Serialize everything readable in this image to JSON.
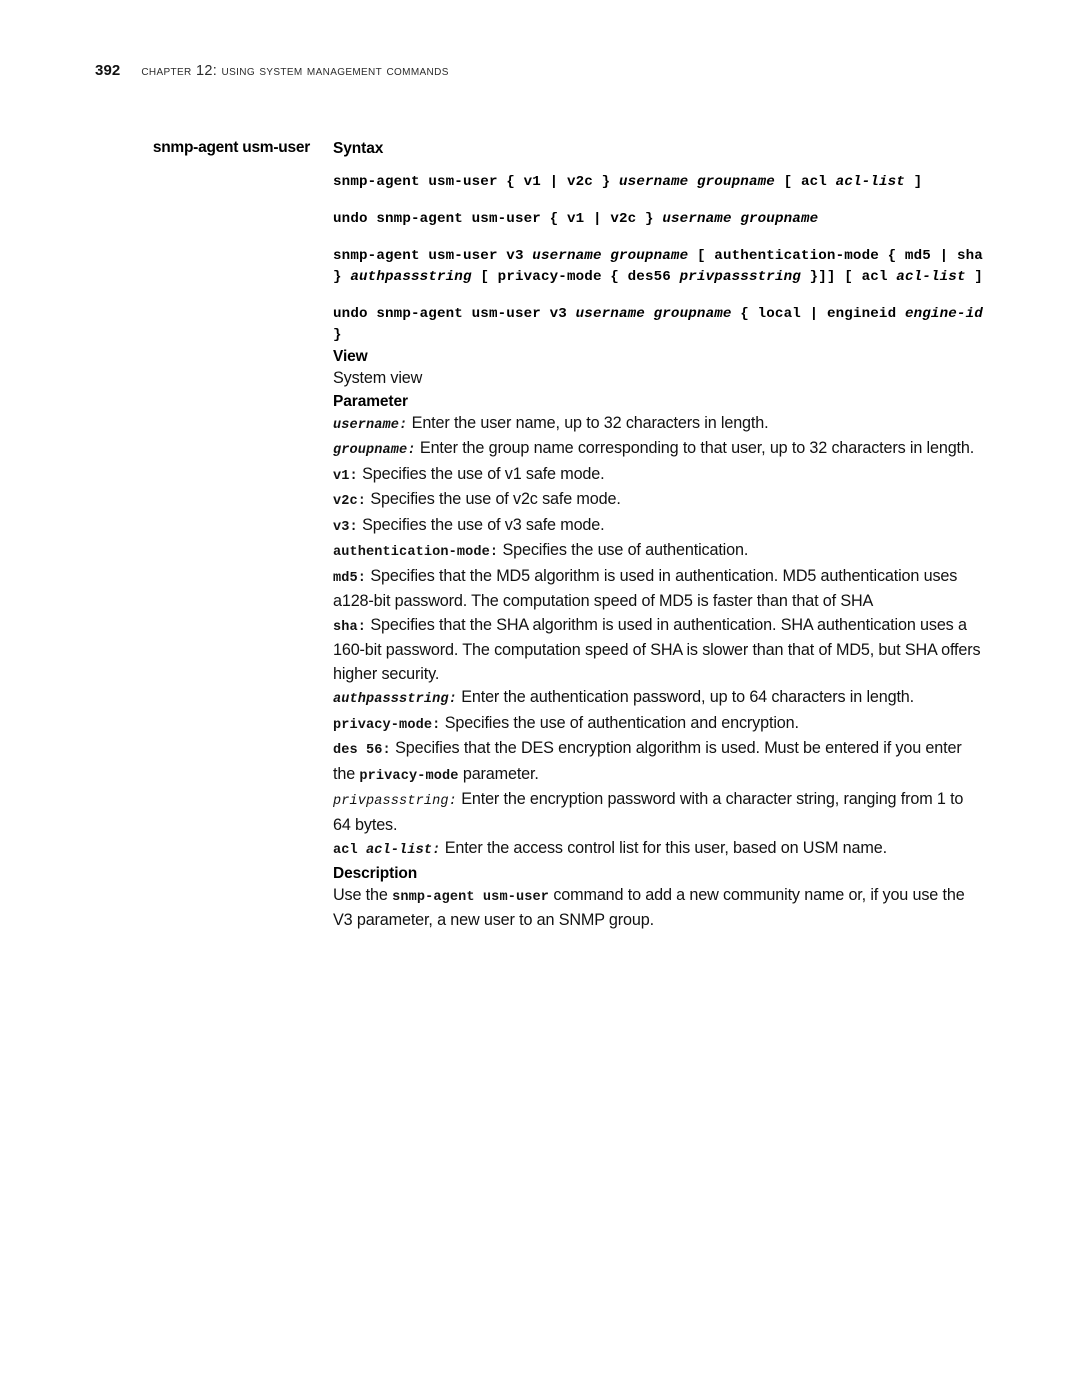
{
  "header": {
    "folio": "392",
    "title": "Chapter 12: Using System Management Commands"
  },
  "margin_heading": "snmp-agent usm-user",
  "sections": {
    "syntax": {
      "heading": "Syntax",
      "lines": [
        "snmp-agent usm-user { v1 | v2c } username groupname [ acl acl-list ]",
        "undo snmp-agent usm-user { v1 | v2c } username groupname",
        "snmp-agent usm-user v3 username groupname [ authentication-mode { md5 | sha } authpassstring [ privacy-mode { des56 privpassstring }]] [ acl acl-list ]",
        "undo snmp-agent usm-user v3 username groupname { local | engineid engine-id }"
      ]
    },
    "view": {
      "heading": "View",
      "text": "System view"
    },
    "parameter": {
      "heading": "Parameter",
      "items": [
        {
          "term": "username:",
          "term_style": "mono-ital",
          "text": " Enter the user name, up to 32 characters in length."
        },
        {
          "term": "groupname:",
          "term_style": "mono-ital",
          "text": " Enter the group name corresponding to that user, up to 32 characters in length."
        },
        {
          "term": "v1:",
          "term_style": "mono",
          "text": " Specifies the use of v1 safe mode."
        },
        {
          "term": "v2c:",
          "term_style": "mono",
          "text": " Specifies the use of v2c safe mode."
        },
        {
          "term": "v3:",
          "term_style": "mono",
          "text": " Specifies the use of v3 safe mode."
        },
        {
          "term": "authentication-mode:",
          "term_style": "mono",
          "text": "  Specifies the use of authentication."
        },
        {
          "term": "md5:",
          "term_style": "mono",
          "text": " Specifies that the MD5 algorithm is used in authentication. MD5 authentication uses a128-bit password. The computation speed of MD5 is faster than that of SHA"
        },
        {
          "term": "sha:",
          "term_style": "mono",
          "text": " Specifies that the SHA algorithm is used in authentication. SHA authentication uses a 160-bit password. The computation speed of SHA is slower than that of MD5, but SHA offers higher security."
        },
        {
          "term": "authpassstring:",
          "term_style": "mono-ital",
          "text": " Enter the authentication password, up to 64 characters in length."
        },
        {
          "term": "privacy-mode:",
          "term_style": "mono",
          "text": " Specifies the use of authentication and encryption."
        },
        {
          "term": "des 56:",
          "term_style": "mono",
          "text_before": " Specifies that the DES encryption algorithm is used. Must be entered if you enter the ",
          "inline_code": "privacy-mode",
          "text_after": " parameter."
        },
        {
          "term": "privpassstring:",
          "term_style": "mono-ital-light",
          "text": " Enter the encryption password with a character string, ranging from 1 to 64 bytes."
        },
        {
          "term_parts": [
            {
              "text": "acl ",
              "style": "mono"
            },
            {
              "text": "acl-list:",
              "style": "mono-ital"
            }
          ],
          "text": " Enter the access control list for this user, based on USM name."
        }
      ]
    },
    "description": {
      "heading": "Description",
      "text_before": "Use the ",
      "inline_code": "snmp-agent usm-user",
      "text_after": " command to add a new community name or, if you use the V3 parameter, a new user to an SNMP group."
    }
  }
}
